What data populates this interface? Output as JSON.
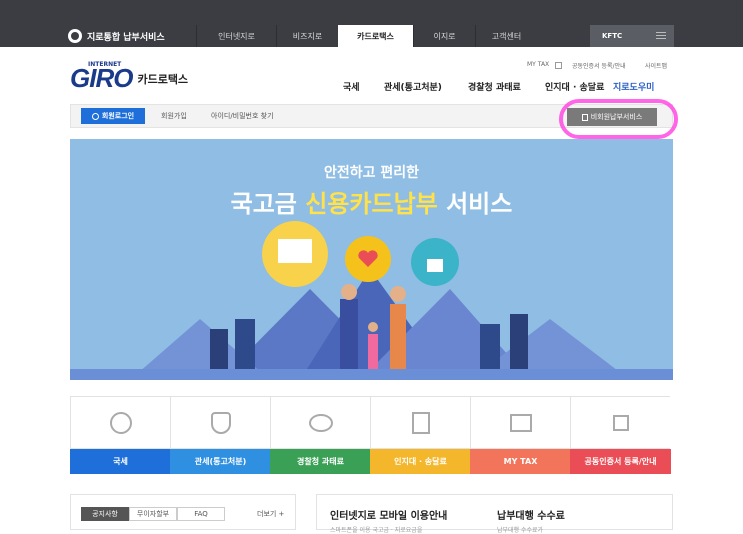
{
  "topnav": {
    "brand": "지로통합 납부서비스",
    "items": [
      "인터넷지로",
      "비즈지로",
      "카드로택스",
      "이지로",
      "고객센터"
    ],
    "active": "카드로택스",
    "kftc": "KFTC"
  },
  "logo": {
    "small": "INTERNET",
    "giro": "GIRO",
    "kr": "카드로택스"
  },
  "util": {
    "mytax": "MY TAX",
    "cert": "공동인증서 등록/안내",
    "sitemap": "사이트맵"
  },
  "gnb": [
    "국세",
    "관세(통고처분)",
    "경찰청 과태료",
    "인지대 · 송달료",
    "지로도우미"
  ],
  "login": {
    "button": "회원로그인",
    "join": "회원가입",
    "find": "아이디/비밀번호 찾기",
    "nonmember": "비회원납부서비스"
  },
  "hero": {
    "sub": "안전하고 편리한",
    "main_pre": "국고금",
    "main_hl": "신용카드납부",
    "main_post": "서비스"
  },
  "services": [
    {
      "label": "국세",
      "color": "#1e6fd9",
      "icon": "nts-icon"
    },
    {
      "label": "관세(통고처분)",
      "color": "#2f8fe0",
      "icon": "customs-icon"
    },
    {
      "label": "경찰청 과태료",
      "color": "#3aa055",
      "icon": "police-icon"
    },
    {
      "label": "인지대 · 송달료",
      "color": "#f4b62a",
      "icon": "document-icon"
    },
    {
      "label": "MY TAX",
      "color": "#f2745b",
      "icon": "mytax-icon"
    },
    {
      "label": "공동인증서 등록/안내",
      "color": "#ea4d55",
      "icon": "lock-icon"
    }
  ],
  "notice": {
    "tabs": [
      "공지사항",
      "무이자할부",
      "FAQ"
    ],
    "more": "더보기 +"
  },
  "mobile": {
    "title": "인터넷지로 모바일 이용안내",
    "sub": "스마트폰을 이용 국고금 · 지로요금을"
  },
  "fee": {
    "title": "납부대행 수수료",
    "sub": "납부대행 수수료가"
  }
}
